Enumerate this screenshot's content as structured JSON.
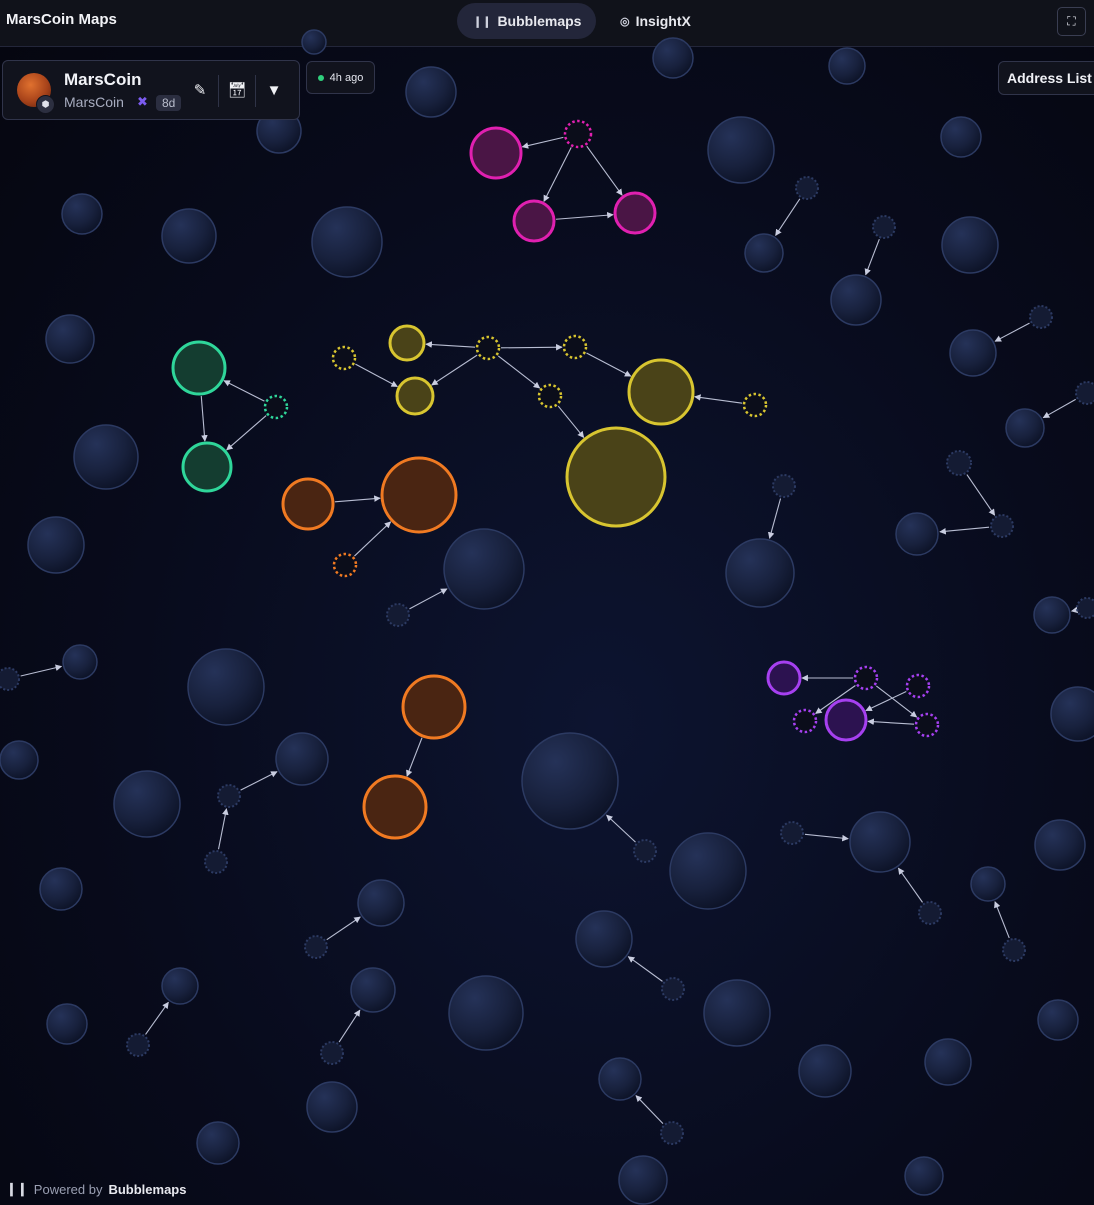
{
  "app": {
    "title": "MarsCoin Maps"
  },
  "tabs": [
    {
      "label": "Bubblemaps",
      "icon": "bubblemaps-logo-icon",
      "active": true
    },
    {
      "label": "InsightX",
      "icon": "insightx-icon",
      "active": false
    }
  ],
  "token": {
    "name": "MarsCoin",
    "symbol": "MarsCoin",
    "age": "8d",
    "chain_icon": "chain-cube-icon",
    "swap_icon": "swap-icon"
  },
  "card_actions": [
    {
      "name": "edit-button",
      "icon": "pencil-icon"
    },
    {
      "name": "calendar-button",
      "icon": "calendar-icon"
    },
    {
      "name": "filter-button",
      "icon": "filter-icon"
    }
  ],
  "status": {
    "text": "4h ago",
    "color": "#2fd07c"
  },
  "address_list": {
    "label": "Address List"
  },
  "footer": {
    "prefix": "Powered by",
    "brand": "Bubblemaps"
  },
  "colors": {
    "background": "#080b1c",
    "bubble_default": "#1b2440",
    "cluster_magenta": "#e020b0",
    "cluster_yellow": "#d8c530",
    "cluster_green": "#2fd69a",
    "cluster_orange": "#f07a22",
    "cluster_purple": "#a640f0"
  }
}
